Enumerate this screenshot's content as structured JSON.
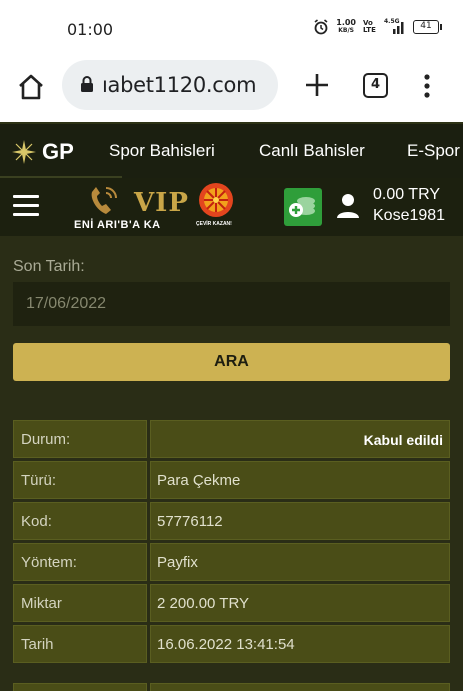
{
  "status_bar": {
    "time": "01:00",
    "speed_value": "1.00",
    "speed_unit": "KB/S",
    "volte": "Vo LTE",
    "network": "4.5G",
    "battery": "41",
    "icons": [
      "alarm-icon",
      "signal-icon",
      "battery-icon"
    ]
  },
  "browser": {
    "url": "ıabet1120.com",
    "tab_count": "4",
    "icons": [
      "home-icon",
      "lock-icon",
      "new-tab-icon",
      "overflow-menu-icon"
    ]
  },
  "site_nav": {
    "logo": "GP",
    "items": [
      "Spor Bahisleri",
      "Canlı Bahisler",
      "E-Spor"
    ]
  },
  "header": {
    "promo_text": "ENİ ARI'B'A KA",
    "vip": "VIP",
    "wheel_label": "ÇEVİR KAZAN!",
    "balance": "0.00 TRY",
    "username": "Kose1981",
    "icons": [
      "hamburger-icon",
      "cash-icon",
      "user-icon"
    ]
  },
  "form": {
    "date_label": "Son Tarih:",
    "date_value": "17/06/2022",
    "search_button": "ARA"
  },
  "details": [
    {
      "key": "Durum:",
      "value": "Kabul edildi"
    },
    {
      "key": "Türü:",
      "value": "Para Çekme"
    },
    {
      "key": "Kod:",
      "value": "57776112"
    },
    {
      "key": "Yöntem:",
      "value": "Payfix"
    },
    {
      "key": "Miktar",
      "value": "2 200.00 TRY"
    },
    {
      "key": "Tarih",
      "value": "16.06.2022 13:41:54"
    }
  ],
  "colors": {
    "accent": "#cdb252",
    "header_bg": "#1b1f10",
    "content_bg": "#2a2d16",
    "cell_bg": "#4a4d17",
    "cash_btn": "#2f9e3a"
  }
}
